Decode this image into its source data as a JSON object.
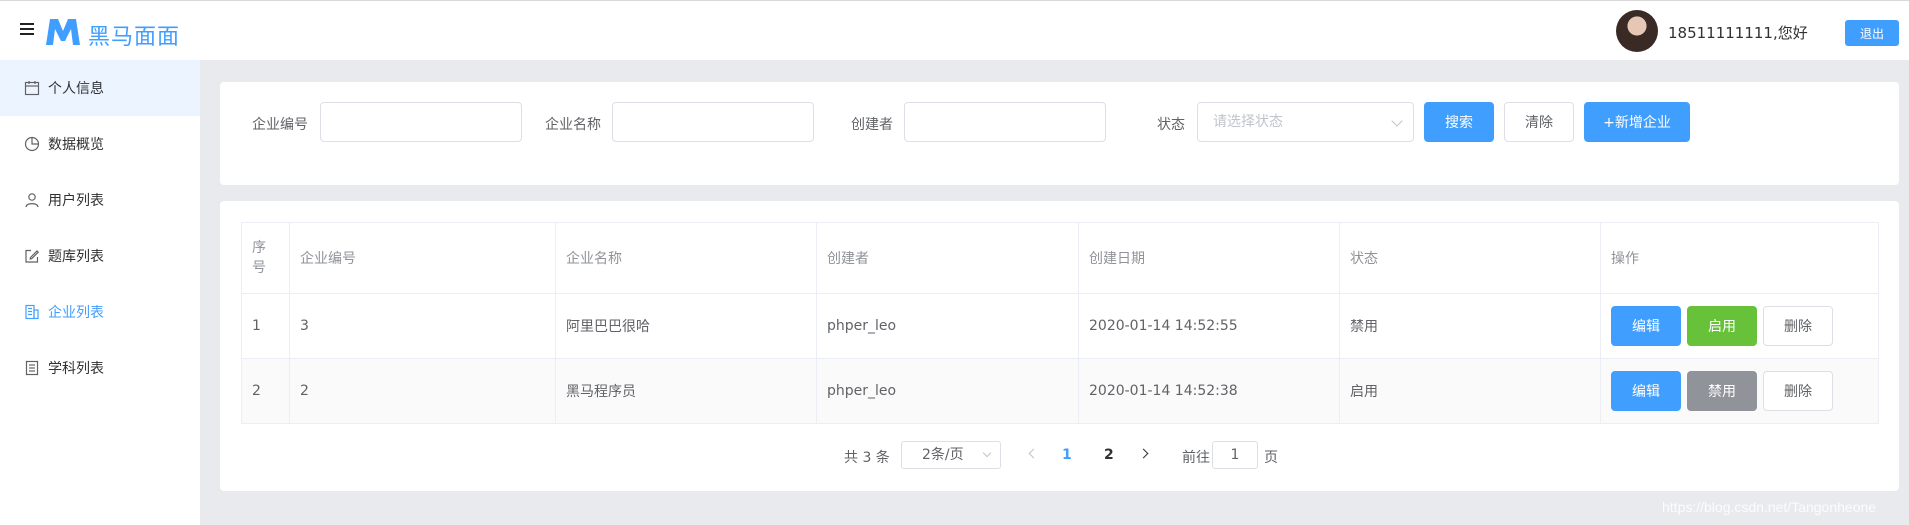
{
  "header": {
    "logo_text": "黑马面面",
    "user_greeting": "18511111111,您好",
    "logout_label": "退出"
  },
  "sidebar": {
    "items": [
      {
        "label": "个人信息",
        "icon": "calendar-icon"
      },
      {
        "label": "数据概览",
        "icon": "pie-chart-icon"
      },
      {
        "label": "用户列表",
        "icon": "user-icon"
      },
      {
        "label": "题库列表",
        "icon": "edit-icon"
      },
      {
        "label": "企业列表",
        "icon": "office-building-icon"
      },
      {
        "label": "学科列表",
        "icon": "tickets-icon"
      }
    ],
    "active_index": 4
  },
  "search": {
    "company_id_label": "企业编号",
    "company_name_label": "企业名称",
    "creator_label": "创建者",
    "status_label": "状态",
    "status_placeholder": "请选择状态",
    "search_btn": "搜索",
    "clear_btn": "清除",
    "add_btn": "+新增企业"
  },
  "table": {
    "headers": [
      "序号",
      "企业编号",
      "企业名称",
      "创建者",
      "创建日期",
      "状态",
      "操作"
    ],
    "rows": [
      {
        "index": "1",
        "id": "3",
        "name": "阿里巴巴很哈",
        "creator": "phper_leo",
        "date": "2020-01-14 14:52:55",
        "status": "禁用",
        "toggle": "启用"
      },
      {
        "index": "2",
        "id": "2",
        "name": "黑马程序员",
        "creator": "phper_leo",
        "date": "2020-01-14 14:52:38",
        "status": "启用",
        "toggle": "禁用"
      }
    ],
    "edit_label": "编辑",
    "delete_label": "删除"
  },
  "pagination": {
    "total": "共 3 条",
    "page_size": "2条/页",
    "pages": [
      "1",
      "2"
    ],
    "current_page": 1,
    "goto_label": "前往",
    "goto_value": "1",
    "page_unit": "页"
  },
  "watermark": "https://blog.csdn.net/Tangonheone",
  "colors": {
    "primary": "#409eff",
    "success": "#67c23a",
    "danger": "#f56c6c",
    "info": "#909399"
  }
}
